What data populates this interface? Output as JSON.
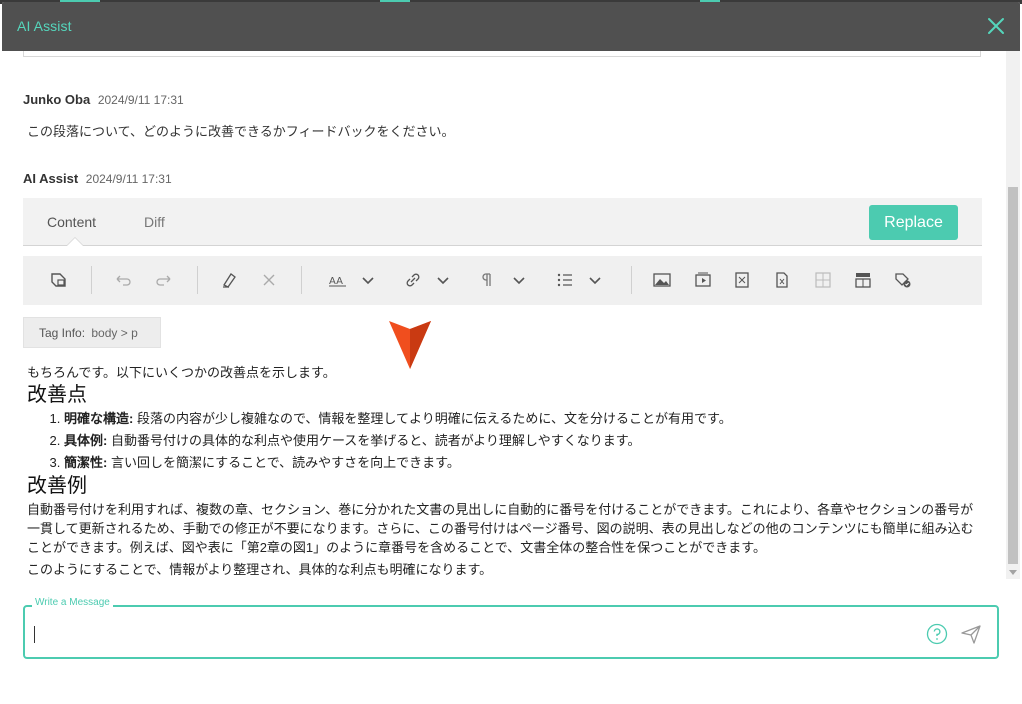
{
  "dialog": {
    "title": "AI Assist",
    "close_icon": "close-icon"
  },
  "messages": [
    {
      "author": "Junko Oba",
      "time": "2024/9/11 17:31",
      "text": "この段落について、どのように改善できるかフィードバックをください。"
    },
    {
      "author": "AI Assist",
      "time": "2024/9/11 17:31"
    }
  ],
  "panel": {
    "tabs": [
      {
        "label": "Content",
        "active": true
      },
      {
        "label": "Diff",
        "active": false
      }
    ],
    "replace_label": "Replace",
    "toolbar_icons": [
      "tag-icon",
      "undo-icon",
      "redo-icon",
      "eraser-icon",
      "clear-icon",
      "font-size-icon",
      "chevron-down-icon",
      "link-icon",
      "chevron-down-icon",
      "paragraph-icon",
      "chevron-down-icon",
      "list-icon",
      "chevron-down-icon",
      "image-icon",
      "video-icon",
      "template-icon",
      "document-icon",
      "table-icon",
      "layout-icon",
      "tag-check-icon"
    ]
  },
  "tag_info": {
    "label": "Tag Info:",
    "path": "body  >  p"
  },
  "content": {
    "intro": "もちろんです。以下にいくつかの改善点を示します。",
    "heading1": "改善点",
    "list": [
      {
        "term": "明確な構造:",
        "text": " 段落の内容が少し複雑なので、情報を整理してより明確に伝えるために、文を分けることが有用です。"
      },
      {
        "term": "具体例:",
        "text": " 自動番号付けの具体的な利点や使用ケースを挙げると、読者がより理解しやすくなります。"
      },
      {
        "term": "簡潔性:",
        "text": " 言い回しを簡潔にすることで、読みやすさを向上できます。"
      }
    ],
    "heading2": "改善例",
    "body": "自動番号付けを利用すれば、複数の章、セクション、巻に分かれた文書の見出しに自動的に番号を付けることができます。これにより、各章やセクションの番号が一貫して更新されるため、手動での修正が不要になります。さらに、この番号付けはページ番号、図の説明、表の見出しなどの他のコンテンツにも簡単に組み込むことができます。例えば、図や表に「第2章の図1」のように章番号を含めることで、文書全体の整合性を保つことができます。",
    "last": "このようにすることで、情報がより整理され、具体的な利点も明確になります。"
  },
  "compose": {
    "legend": "Write a Message",
    "value": "",
    "help_icon": "help-icon",
    "send_icon": "send-icon"
  },
  "colors": {
    "accent": "#4ccbb0",
    "titlebar": "#505050"
  }
}
